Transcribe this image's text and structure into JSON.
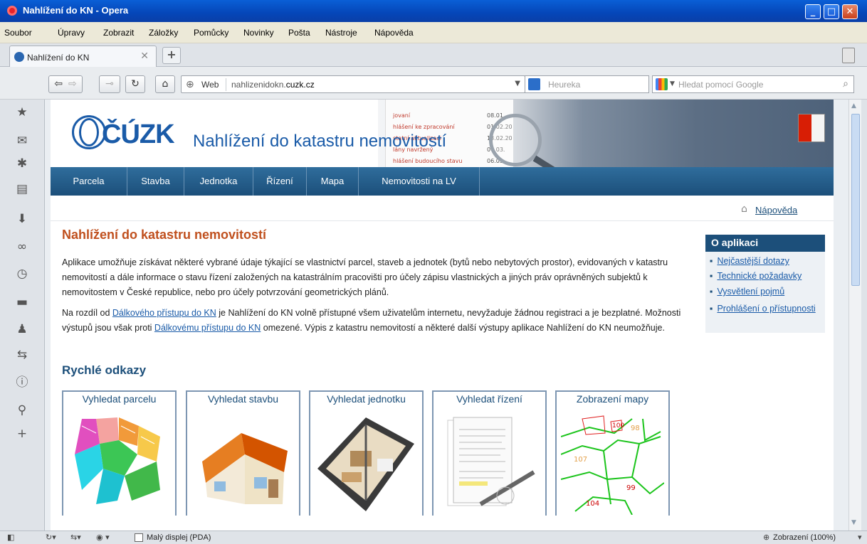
{
  "window": {
    "title": "Nahlížení do KN - Opera"
  },
  "menu": [
    "Soubor",
    "Úpravy",
    "Zobrazit",
    "Záložky",
    "Pomůcky",
    "Novinky",
    "Pošta",
    "Nástroje",
    "Nápověda"
  ],
  "tab": {
    "label": "Nahlížení do KN"
  },
  "address": {
    "mode": "Web",
    "url_prefix": "nahlizenidokn.",
    "url_domain": "cuzk.cz",
    "search1_placeholder": "Heureka",
    "search2_placeholder": "Hledat pomocí Google"
  },
  "banner": {
    "logo_text": "ČÚZK",
    "site_title": "Nahlížení do katastru nemovitostí",
    "doc_lines": [
      "jovaní",
      "hlášení ke zpracování",
      "statní aktualizaci",
      "lány navržený",
      "hlášení budoucího stavu"
    ],
    "doc_dates": [
      "08.01.",
      "01.02.20",
      "13.02.20",
      "06.03.",
      "06.03"
    ]
  },
  "nav": [
    "Parcela",
    "Stavba",
    "Jednotka",
    "Řízení",
    "Mapa",
    "Nemovitosti na LV"
  ],
  "help_link": "Nápověda",
  "heading": "Nahlížení do katastru nemovitostí",
  "intro": "Aplikace umožňuje získávat některé vybrané údaje týkající se vlastnictví parcel, staveb a jednotek (bytů nebo nebytových prostor), evidovaných v katastru nemovitostí a dále informace o stavu řízení založených na katastrálním pracovišti pro účely zápisu vlastnických a jiných práv oprávněných subjektů k nemovitostem v České republice, nebo pro účely potvrzování geometrických plánů.",
  "second": {
    "t1": "Na rozdíl od ",
    "link1": "Dálkového přístupu do KN",
    "t2": " je Nahlížení do KN volně přístupné všem uživatelům internetu, nevyžaduje žádnou registraci a je bezplatné. Možnosti výstupů jsou však proti ",
    "link2": "Dálkovému přístupu do KN",
    "t3": " omezené. Výpis z katastru nemovitostí a některé další výstupy aplikace Nahlížení do KN neumožňuje."
  },
  "quick_heading": "Rychlé odkazy",
  "cards": [
    "Vyhledat parcelu",
    "Vyhledat stavbu",
    "Vyhledat jednotku",
    "Vyhledat řízení",
    "Zobrazení mapy"
  ],
  "map_numbers": [
    "100",
    "98",
    "107",
    "99",
    "104"
  ],
  "sidebar": {
    "title": "O aplikaci",
    "items": [
      "Nejčastější dotazy",
      "Technické požadavky",
      "Vysvětlení pojmů",
      "Prohlášení o přístupnosti"
    ]
  },
  "status": {
    "pda": "Malý displej (PDA)",
    "zoom": "Zobrazení (100%)"
  },
  "colors": {
    "nav_bg": "#1c4f7a",
    "heading": "#c0501e",
    "link": "#1a5ba8"
  }
}
